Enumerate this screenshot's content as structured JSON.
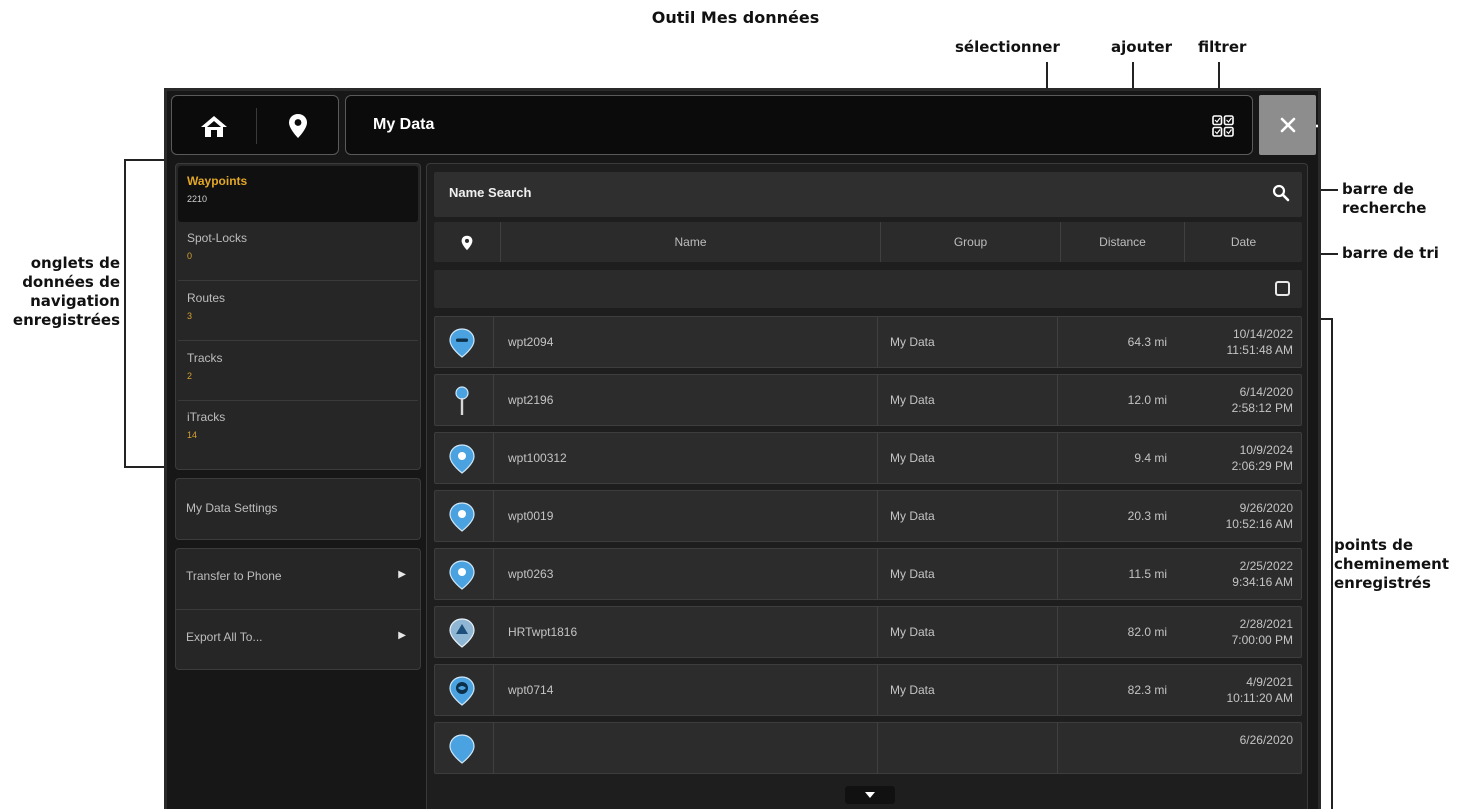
{
  "annotations": {
    "title": "Outil Mes données",
    "select": "sélectionner",
    "add": "ajouter",
    "filter": "filtrer",
    "search_bar": [
      "barre de",
      "recherche"
    ],
    "sort_bar": "barre de tri",
    "tabs": [
      "onglets de",
      "données de",
      "navigation",
      "enregistrées"
    ],
    "waypoints": [
      "points de",
      "cheminement",
      "enregistrés"
    ]
  },
  "topbar": {
    "title": "My Data",
    "icons": [
      "home-icon",
      "waypoint-pin-icon",
      "select-grid-icon",
      "plus-icon",
      "filter-icon",
      "close-icon"
    ]
  },
  "sidebar": {
    "tabs": [
      {
        "label": "Waypoints",
        "count": "2210",
        "active": true
      },
      {
        "label": "Spot-Locks",
        "count": "0",
        "active": false
      },
      {
        "label": "Routes",
        "count": "3",
        "active": false
      },
      {
        "label": "Tracks",
        "count": "2",
        "active": false
      },
      {
        "label": "iTracks",
        "count": "14",
        "active": false
      }
    ],
    "settings_label": "My Data Settings",
    "actions": [
      {
        "label": "Transfer to Phone",
        "arrow": "▶"
      },
      {
        "label": "Export All To...",
        "arrow": "▶"
      }
    ]
  },
  "list": {
    "search_label": "Name Search",
    "columns": [
      "Name",
      "Group",
      "Distance",
      "Date"
    ],
    "rows": [
      {
        "icon": "waypoint-dash-icon",
        "name": "wpt2094",
        "group": "My Data",
        "distance": "64.3 mi",
        "date": "10/14/2022",
        "time": "11:51:48 AM"
      },
      {
        "icon": "pushpin-icon",
        "name": "wpt2196",
        "group": "My Data",
        "distance": "12.0 mi",
        "date": "6/14/2020",
        "time": "2:58:12 PM"
      },
      {
        "icon": "waypoint-drop-icon",
        "name": "wpt100312",
        "group": "My Data",
        "distance": "9.4 mi",
        "date": "10/9/2024",
        "time": "2:06:29 PM"
      },
      {
        "icon": "waypoint-drop-icon",
        "name": "wpt0019",
        "group": "My Data",
        "distance": "20.3 mi",
        "date": "9/26/2020",
        "time": "10:52:16 AM"
      },
      {
        "icon": "waypoint-drop-icon",
        "name": "wpt0263",
        "group": "My Data",
        "distance": "11.5 mi",
        "date": "2/25/2022",
        "time": "9:34:16 AM"
      },
      {
        "icon": "waypoint-triangle-icon",
        "name": "HRTwpt1816",
        "group": "My Data",
        "distance": "82.0 mi",
        "date": "2/28/2021",
        "time": "7:00:00 PM"
      },
      {
        "icon": "waypoint-fish-icon",
        "name": "wpt0714",
        "group": "My Data",
        "distance": "82.3 mi",
        "date": "4/9/2021",
        "time": "10:11:20 AM"
      },
      {
        "icon": "waypoint-circle-icon",
        "name": "",
        "group": "",
        "distance": "",
        "date": "6/26/2020",
        "time": ""
      }
    ]
  },
  "colors": {
    "accent": "#e3a726",
    "icon_blue": "#4aa3e0",
    "background": "#171717"
  }
}
